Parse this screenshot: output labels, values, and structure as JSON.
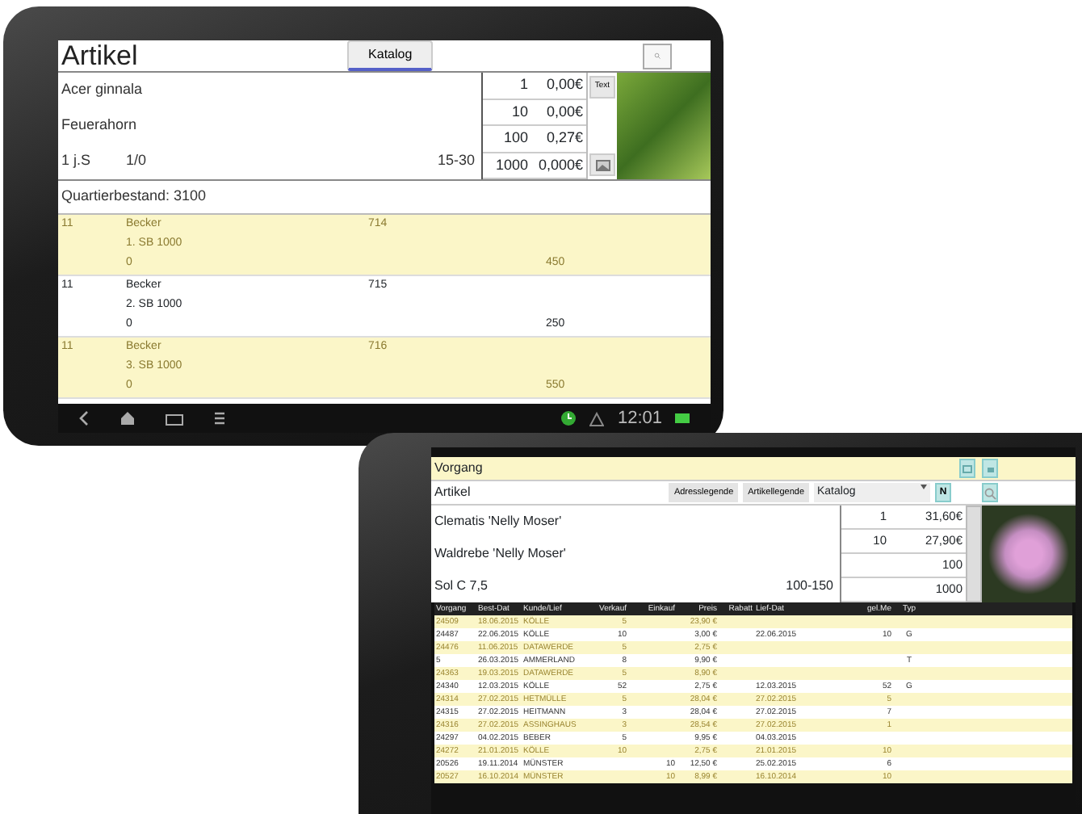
{
  "tablet_top": {
    "header": {
      "title": "Artikel",
      "tabs": [
        {
          "label": "Katalog",
          "selected": true
        }
      ]
    },
    "article": {
      "name": "Acer ginnala",
      "common_name": "Feuerahorn",
      "age": "1 j.S",
      "ratio": "1/0",
      "size": "15-30"
    },
    "prices": [
      {
        "qty": "1",
        "price": "0,00€"
      },
      {
        "qty": "10",
        "price": "0,00€"
      },
      {
        "qty": "100",
        "price": "0,27€"
      },
      {
        "qty": "1000",
        "price": "0,000€"
      }
    ],
    "text_button": "Text",
    "stock": "Quartierbestand: 3100",
    "rows": [
      {
        "column_1": "11",
        "supplier": "Becker",
        "line_2": "1. SB 1000",
        "line_3": "0",
        "number": "714",
        "quantity": "450",
        "highlighted": true
      },
      {
        "column_1": "11",
        "supplier": "Becker",
        "line_2": "2. SB 1000",
        "line_3": "0",
        "number": "715",
        "quantity": "250",
        "highlighted": false
      },
      {
        "column_1": "11",
        "supplier": "Becker",
        "line_2": "3. SB 1000",
        "line_3": "0",
        "number": "716",
        "quantity": "550",
        "highlighted": true
      }
    ],
    "status_bar": {
      "time": "12:01"
    }
  },
  "tablet_bottom": {
    "title": "Vorgang",
    "toolbar": {
      "label": "Artikel",
      "buttons": [
        "Adresslegende",
        "Artikellegende"
      ],
      "select": "Katalog",
      "new_button": "N"
    },
    "article": {
      "name": "Clematis 'Nelly Moser'",
      "common_name": "Waldrebe 'Nelly Moser'",
      "variety": "Sol C 7,5",
      "size": "100-150"
    },
    "prices": [
      {
        "qty": "1",
        "price": "31,60€"
      },
      {
        "qty": "10",
        "price": "27,90€"
      },
      {
        "qty": "100"
      },
      {
        "qty": "1000"
      }
    ],
    "table": {
      "columns": [
        "Vorgang",
        "Best-Dat",
        "Kunde/Lief",
        "Verkauf",
        "Einkauf",
        "Preis",
        "Rabatt",
        "Lief-Dat",
        "gel.Me",
        "Typ"
      ],
      "rows": [
        [
          "24509",
          "18.06.2015",
          "KÖLLE",
          "5",
          "",
          "23,90 €",
          "",
          "",
          "",
          ""
        ],
        [
          "24487",
          "22.06.2015",
          "KÖLLE",
          "10",
          "",
          "3,00 €",
          "",
          "22.06.2015",
          "10",
          "G"
        ],
        [
          "24476",
          "11.06.2015",
          "DATAWERDE",
          "5",
          "",
          "2,75 €",
          "",
          "",
          "",
          ""
        ],
        [
          "5",
          "26.03.2015",
          "AMMERLAND",
          "8",
          "",
          "9,90 €",
          "",
          "",
          "",
          "T"
        ],
        [
          "24363",
          "19.03.2015",
          "DATAWERDE",
          "5",
          "",
          "8,90 €",
          "",
          "",
          "",
          ""
        ],
        [
          "24340",
          "12.03.2015",
          "KÖLLE",
          "52",
          "",
          "2,75 €",
          "",
          "12.03.2015",
          "52",
          "G"
        ],
        [
          "24314",
          "27.02.2015",
          "HETMÜLLE",
          "5",
          "",
          "28,04 €",
          "",
          "27.02.2015",
          "5",
          ""
        ],
        [
          "24315",
          "27.02.2015",
          "HEITMANN",
          "3",
          "",
          "28,04 €",
          "",
          "27.02.2015",
          "7",
          ""
        ],
        [
          "24316",
          "27.02.2015",
          "ASSINGHAUS",
          "3",
          "",
          "28,54 €",
          "",
          "27.02.2015",
          "1",
          ""
        ],
        [
          "24297",
          "04.02.2015",
          "BEBER",
          "5",
          "",
          "9,95 €",
          "",
          "04.03.2015",
          "",
          ""
        ],
        [
          "24272",
          "21.01.2015",
          "KÖLLE",
          "10",
          "",
          "2,75 €",
          "",
          "21.01.2015",
          "10",
          ""
        ],
        [
          "20526",
          "19.11.2014",
          "MÜNSTER",
          "",
          "10",
          "12,50 €",
          "",
          "25.02.2015",
          "6",
          ""
        ],
        [
          "20527",
          "16.10.2014",
          "MÜNSTER",
          "",
          "10",
          "8,99 €",
          "",
          "16.10.2014",
          "10",
          ""
        ]
      ]
    }
  }
}
